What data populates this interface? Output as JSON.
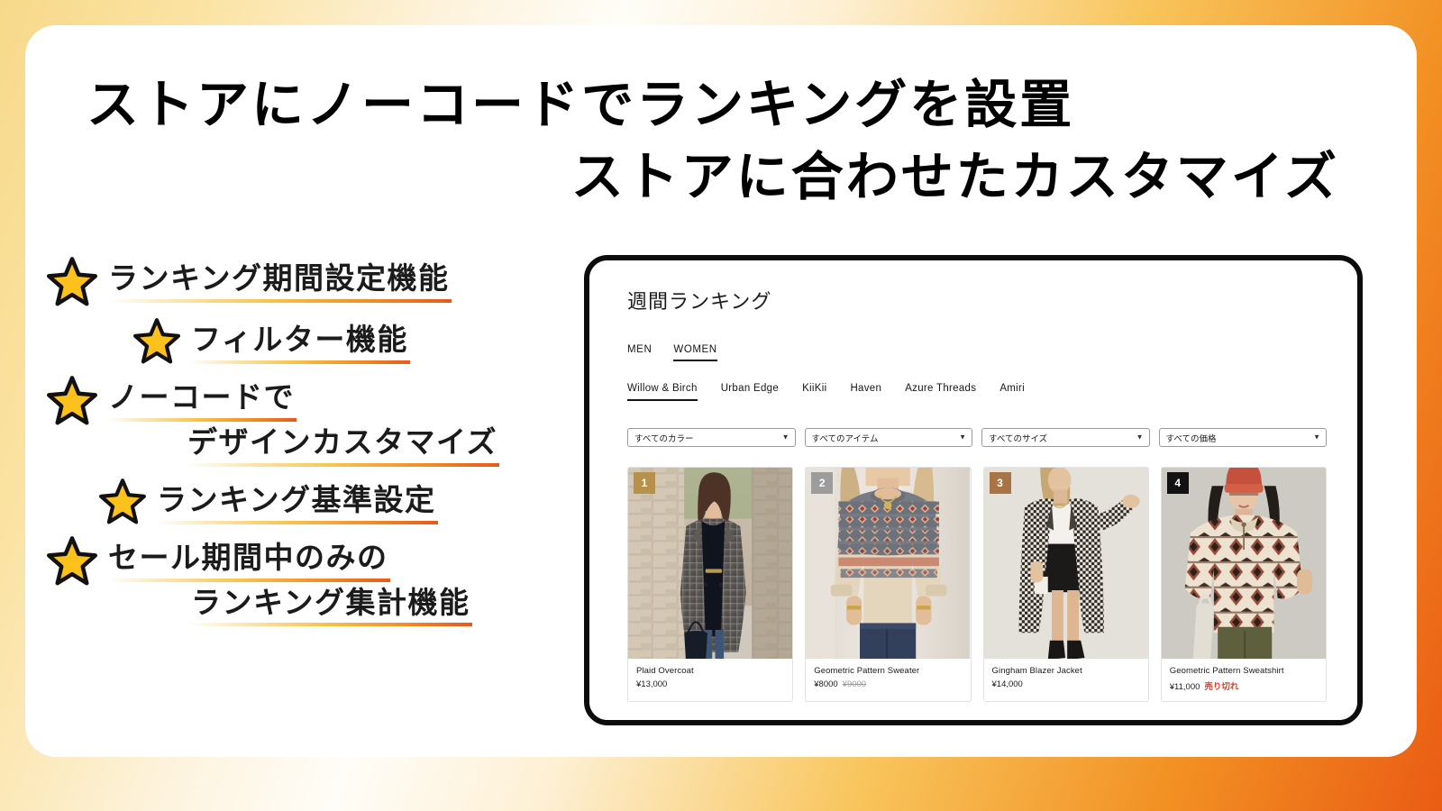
{
  "headline": {
    "line1": "ストアにノーコードでランキングを設置",
    "line2": "ストアに合わせたカスタマイズ"
  },
  "features": [
    {
      "icon": "star-icon",
      "lines": [
        "ランキング期間設定機能"
      ]
    },
    {
      "icon": "star-icon",
      "lines": [
        "フィルター機能"
      ]
    },
    {
      "icon": "star-icon",
      "lines": [
        "ノーコードで",
        "デザインカスタマイズ"
      ]
    },
    {
      "icon": "star-icon",
      "lines": [
        "ランキング基準設定"
      ]
    },
    {
      "icon": "star-icon",
      "lines": [
        "セール期間中のみの",
        "ランキング集計機能"
      ]
    }
  ],
  "mockup": {
    "title": "週間ランキング",
    "gender_tabs": [
      {
        "label": "MEN",
        "active": false
      },
      {
        "label": "WOMEN",
        "active": true
      }
    ],
    "brand_tabs": [
      {
        "label": "Willow & Birch",
        "active": true
      },
      {
        "label": "Urban Edge",
        "active": false
      },
      {
        "label": "KiiKii",
        "active": false
      },
      {
        "label": "Haven",
        "active": false
      },
      {
        "label": "Azure Threads",
        "active": false
      },
      {
        "label": "Amiri",
        "active": false
      }
    ],
    "filters": [
      {
        "value": "すべてのカラー",
        "caret": "chevron-down-icon"
      },
      {
        "value": "すべてのアイテム",
        "caret": "chevron-down-icon"
      },
      {
        "value": "すべてのサイズ",
        "caret": "chevron-down-icon"
      },
      {
        "value": "すべての価格",
        "caret": "chevron-down-icon"
      }
    ],
    "products": [
      {
        "rank": "1",
        "rank_color": "#b79049",
        "name": "Plaid Overcoat",
        "price": "¥13,000",
        "old_price": "",
        "status": ""
      },
      {
        "rank": "2",
        "rank_color": "#9c9c9c",
        "name": "Geometric Pattern Sweater",
        "price": "¥8000",
        "old_price": "¥9000",
        "status": ""
      },
      {
        "rank": "3",
        "rank_color": "#a87445",
        "name": "Gingham Blazer Jacket",
        "price": "¥14,000",
        "old_price": "",
        "status": ""
      },
      {
        "rank": "4",
        "rank_color": "#121212",
        "name": "Geometric Pattern Sweatshirt",
        "price": "¥11,000",
        "old_price": "",
        "status": "売り切れ"
      }
    ]
  },
  "colors": {
    "accent_orange": "#ea5c14",
    "accent_yellow": "#f7d98a",
    "star_fill": "#fcc21b",
    "sold_out_red": "#e23b28"
  }
}
